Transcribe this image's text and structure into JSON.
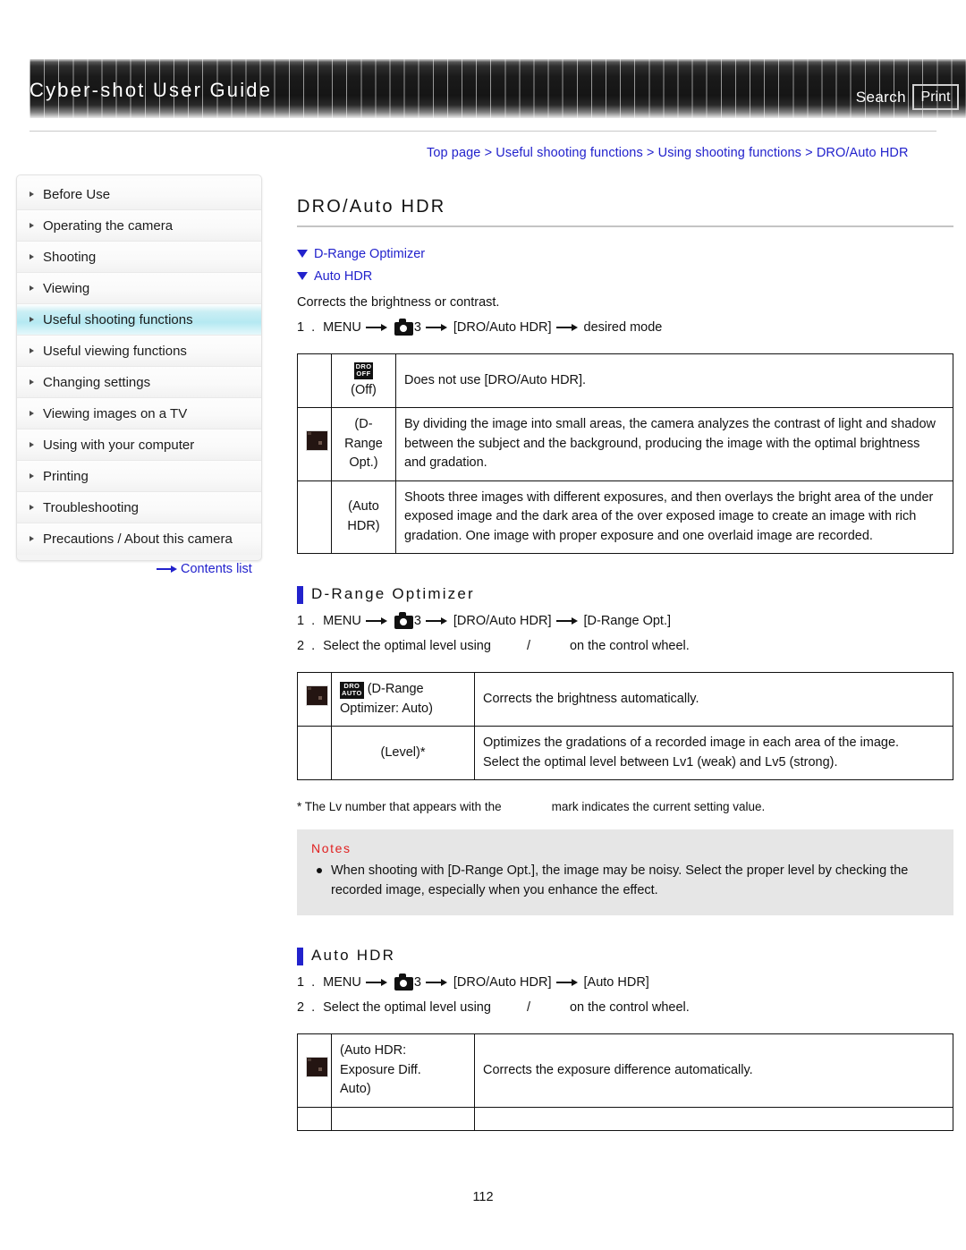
{
  "header": {
    "title": "Cyber-shot User Guide",
    "search_label": "Search",
    "print_label": "Print"
  },
  "breadcrumb": {
    "full": "Top page > Useful shooting functions > Using shooting functions > DRO/Auto HDR",
    "items": [
      "Top page",
      "Useful shooting functions",
      "Using shooting functions",
      "DRO/Auto HDR"
    ],
    "separator": ">"
  },
  "sidebar": {
    "items": [
      {
        "label": "Before Use",
        "active": false
      },
      {
        "label": "Operating the camera",
        "active": false
      },
      {
        "label": "Shooting",
        "active": false
      },
      {
        "label": "Viewing",
        "active": false
      },
      {
        "label": "Useful shooting functions",
        "active": true
      },
      {
        "label": "Useful viewing functions",
        "active": false
      },
      {
        "label": "Changing settings",
        "active": false
      },
      {
        "label": "Viewing images on a TV",
        "active": false
      },
      {
        "label": "Using with your computer",
        "active": false
      },
      {
        "label": "Printing",
        "active": false
      },
      {
        "label": "Troubleshooting",
        "active": false
      },
      {
        "label": "Precautions / About this camera",
        "active": false
      }
    ],
    "contents_link": "Contents list",
    "active_color": "#b5e9f2",
    "link_color": "#2222cc"
  },
  "main": {
    "page_title": "DRO/Auto HDR",
    "anchors": [
      {
        "label": "D-Range Optimizer"
      },
      {
        "label": "Auto HDR"
      }
    ],
    "lead": "Corrects the brightness or contrast.",
    "step1": {
      "num": "1 .",
      "p1": "MENU",
      "menu_index": "3",
      "p2": "[DRO/Auto HDR]",
      "p3": "desired mode"
    },
    "table1": {
      "rows": [
        {
          "icon": "dro-off-badge",
          "badge_line1": "DRO",
          "badge_line2": "OFF",
          "name": "(Off)",
          "desc": "Does not use [DRO/Auto HDR]."
        },
        {
          "icon": "thumbnail-dark",
          "name": "(D-\nRange\nOpt.)",
          "name_l1": "(D-",
          "name_l2": "Range",
          "name_l3": "Opt.)",
          "desc": "By dividing the image into small areas, the camera analyzes the contrast of light and shadow between the subject and the background, producing the image with the optimal brightness and gradation."
        },
        {
          "icon": "none",
          "name_l1": "(Auto",
          "name_l2": "HDR)",
          "desc": "Shoots three images with different exposures, and then overlays the bright area of the under exposed image and the dark area of the over exposed image to create an image with rich gradation. One image with proper exposure and one overlaid image are recorded."
        }
      ]
    },
    "section_dro": {
      "heading": "D-Range Optimizer",
      "step1": {
        "num": "1 .",
        "p1": "MENU",
        "menu_index": "3",
        "p2": "[DRO/Auto HDR]",
        "p3": "[D-Range Opt.]"
      },
      "step2": {
        "num": "2 .",
        "p1": "Select the optimal level using",
        "slash": "/",
        "p2": "on the control wheel."
      },
      "table": {
        "rows": [
          {
            "icon": "thumbnail-dark",
            "badge_line1": "DRO",
            "badge_line2": "AUTO",
            "name_l1": "(D-Range",
            "name_l2": "Optimizer: Auto)",
            "desc": "Corrects the brightness automatically."
          },
          {
            "icon": "none",
            "name_l1": "(Level)*",
            "desc_l1": "Optimizes the gradations of a recorded image in each area of the image.",
            "desc_l2": "Select the optimal level between Lv1 (weak) and Lv5 (strong)."
          }
        ]
      },
      "footnote_a": "* The Lv number that appears with the",
      "footnote_b": "mark indicates the current setting value.",
      "notes": {
        "title": "Notes",
        "items": [
          "When shooting with [D-Range Opt.], the image may be noisy. Select the proper level by checking the recorded image, especially when you enhance the effect."
        ]
      }
    },
    "section_hdr": {
      "heading": "Auto HDR",
      "step1": {
        "num": "1 .",
        "p1": "MENU",
        "menu_index": "3",
        "p2": "[DRO/Auto HDR]",
        "p3": "[Auto HDR]"
      },
      "step2": {
        "num": "2 .",
        "p1": "Select the optimal level using",
        "slash": "/",
        "p2": "on the control wheel."
      },
      "table": {
        "rows": [
          {
            "icon": "thumbnail-dark",
            "name_l1": "(Auto HDR:",
            "name_l2": "Exposure Diff.",
            "name_l3": "Auto)",
            "desc": "Corrects the exposure difference automatically."
          }
        ]
      }
    }
  },
  "footer": {
    "page_number": "112"
  },
  "colors": {
    "link": "#2222cc",
    "notes_title": "#e02020",
    "notes_bg": "#e6e6e6",
    "accent_bar": "#2222cc",
    "header_bg": "#1a1a1a"
  }
}
